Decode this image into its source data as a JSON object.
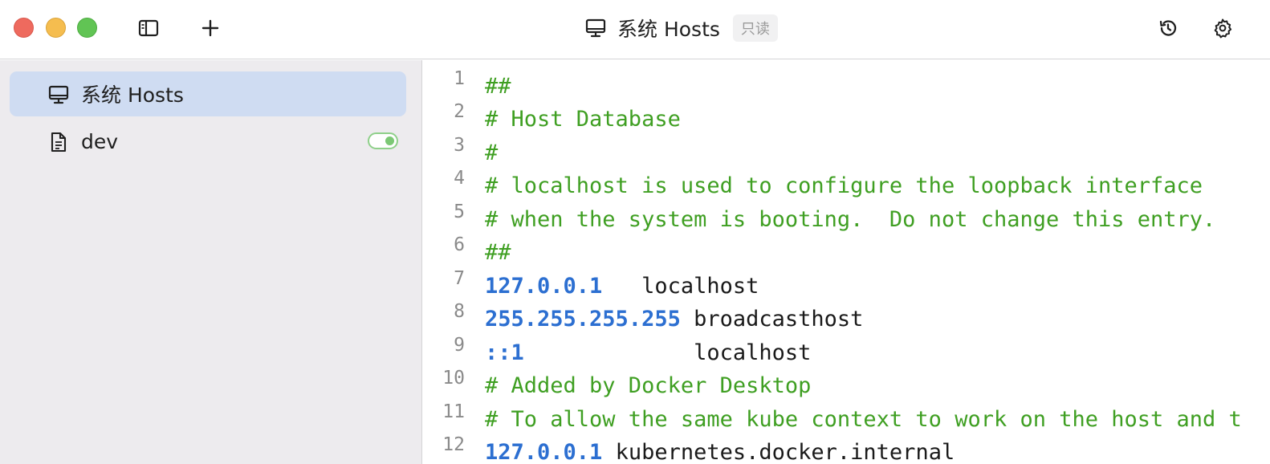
{
  "titlebar": {
    "title": "系统 Hosts",
    "badge": "只读"
  },
  "sidebar": {
    "items": [
      {
        "label": "系统 Hosts",
        "icon": "monitor-icon",
        "active": true
      },
      {
        "label": "dev",
        "icon": "file-icon",
        "active": false,
        "enabled": true
      }
    ]
  },
  "editor": {
    "lines": [
      {
        "num": "1",
        "segments": [
          {
            "t": "##",
            "k": "comment"
          }
        ]
      },
      {
        "num": "2",
        "segments": [
          {
            "t": "# Host Database",
            "k": "comment"
          }
        ]
      },
      {
        "num": "3",
        "segments": [
          {
            "t": "#",
            "k": "comment"
          }
        ]
      },
      {
        "num": "4",
        "segments": [
          {
            "t": "# localhost is used to configure the loopback interface",
            "k": "comment"
          }
        ]
      },
      {
        "num": "5",
        "segments": [
          {
            "t": "# when the system is booting.  Do not change this entry.",
            "k": "comment"
          }
        ]
      },
      {
        "num": "6",
        "segments": [
          {
            "t": "##",
            "k": "comment"
          }
        ]
      },
      {
        "num": "7",
        "segments": [
          {
            "t": "127.0.0.1",
            "k": "ip"
          },
          {
            "t": "   localhost",
            "k": "host"
          }
        ]
      },
      {
        "num": "8",
        "segments": [
          {
            "t": "255.255.255.255",
            "k": "ip"
          },
          {
            "t": " broadcasthost",
            "k": "host"
          }
        ]
      },
      {
        "num": "9",
        "segments": [
          {
            "t": "::1",
            "k": "ip"
          },
          {
            "t": "             localhost",
            "k": "host"
          }
        ]
      },
      {
        "num": "10",
        "segments": [
          {
            "t": "# Added by Docker Desktop",
            "k": "comment"
          }
        ]
      },
      {
        "num": "11",
        "segments": [
          {
            "t": "# To allow the same kube context to work on the host and t",
            "k": "comment"
          }
        ]
      },
      {
        "num": "12",
        "segments": [
          {
            "t": "127.0.0.1",
            "k": "ip"
          },
          {
            "t": " kubernetes.docker.internal",
            "k": "host"
          }
        ]
      }
    ]
  },
  "colors": {
    "comment": "#3f9f22",
    "ip": "#2c6fd1",
    "sidebar_active": "#cfdcf2",
    "sidebar_bg": "#edebee"
  }
}
